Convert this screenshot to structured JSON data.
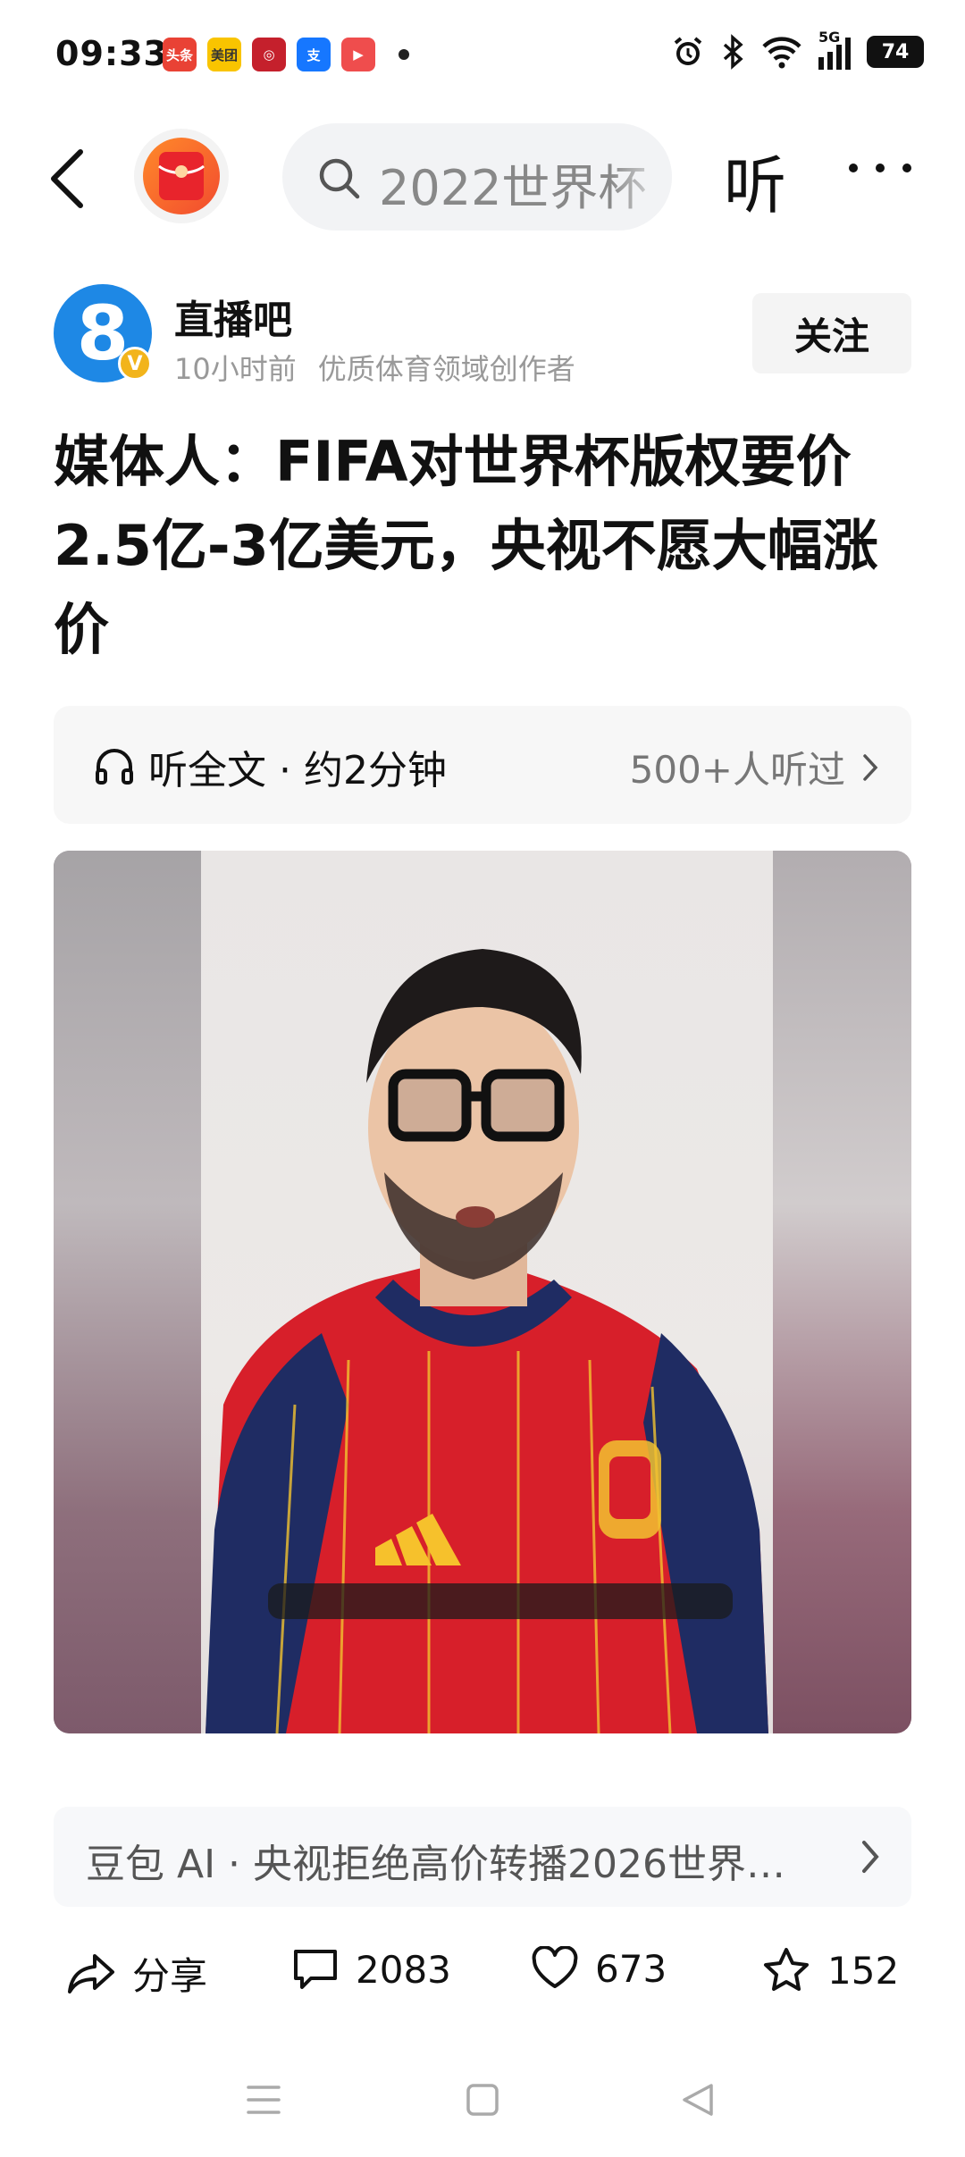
{
  "status_bar": {
    "time": "09:33",
    "apps": [
      {
        "name": "头条",
        "color": "#e94235"
      },
      {
        "name": "美团",
        "color": "#f9c400"
      },
      {
        "name": "银行",
        "color": "#c5202c"
      },
      {
        "name": "支",
        "color": "#1677ff"
      },
      {
        "name": "视频",
        "color": "#ef4d4d"
      }
    ],
    "battery": "74",
    "network": "5G"
  },
  "nav": {
    "search_text": "2022世界杯",
    "listen_label": "听"
  },
  "author": {
    "avatar_text": "8",
    "verified_badge": "V",
    "name": "直播吧",
    "time": "10小时前",
    "tag": "优质体育领域创作者",
    "follow_label": "关注"
  },
  "article": {
    "title": "媒体人：FIFA对世界杯版权要价2.5亿-3亿美元，央视不愿大幅涨价"
  },
  "listen_card": {
    "label": "听全文 · 约2分钟",
    "count": "500+人听过"
  },
  "ai_summary": {
    "text": "豆包 AI · 央视拒绝高价转播2026世界…"
  },
  "actions": {
    "share": "分享",
    "comments": "2083",
    "likes": "673",
    "favorites": "152"
  }
}
